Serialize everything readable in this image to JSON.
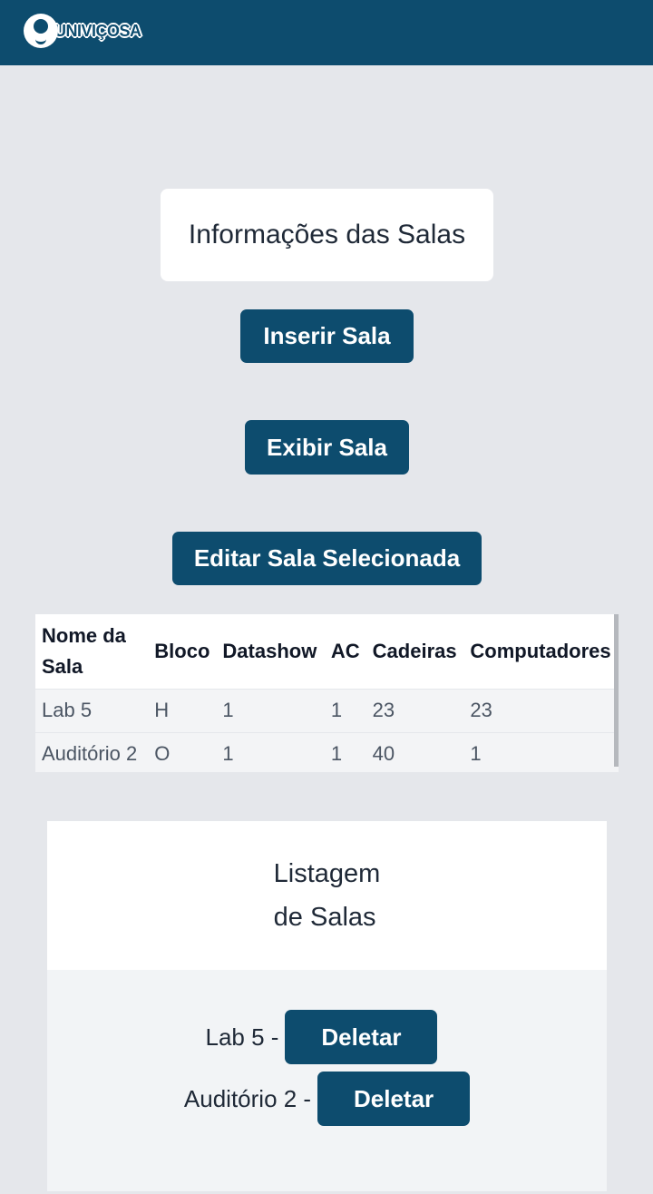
{
  "header": {
    "logo_text": "UNIVIÇOSA"
  },
  "title": "Informações das Salas",
  "buttons": {
    "insert": "Inserir Sala",
    "show": "Exibir Sala",
    "edit": "Editar Sala Selecionada"
  },
  "table": {
    "columns": [
      "Nome da Sala",
      "Bloco",
      "Datashow",
      "AC",
      "Cadeiras",
      "Computadores"
    ],
    "rows": [
      [
        "Lab 5",
        "H",
        "1",
        "1",
        "23",
        "23"
      ],
      [
        "Auditório 2",
        "O",
        "1",
        "1",
        "40",
        "1"
      ]
    ]
  },
  "listing": {
    "title_line1": "Listagem",
    "title_line2": "de Salas",
    "items": [
      {
        "label": "Lab 5 -",
        "delete_label": "Deletar"
      },
      {
        "label": "Auditório 2 -",
        "delete_label": "Deletar"
      }
    ]
  }
}
